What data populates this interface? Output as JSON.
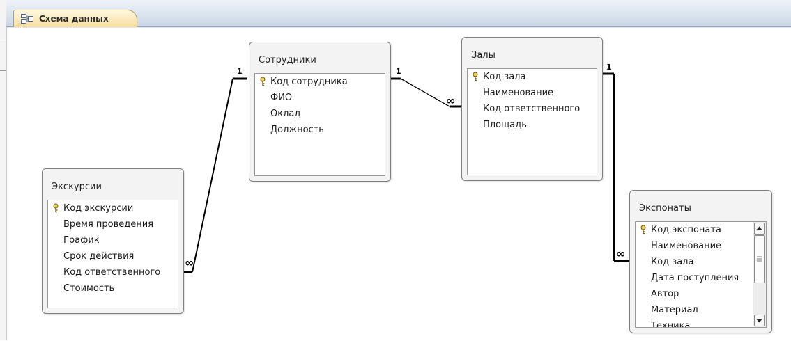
{
  "tab": {
    "label": "Схема данных",
    "icon": "relationships-icon"
  },
  "tables": {
    "sotrudniki": {
      "title": "Сотрудники",
      "fields": [
        {
          "name": "Код сотрудника",
          "key": true
        },
        {
          "name": "ФИО",
          "key": false
        },
        {
          "name": "Оклад",
          "key": false
        },
        {
          "name": "Должность",
          "key": false
        }
      ]
    },
    "zaly": {
      "title": "Залы",
      "fields": [
        {
          "name": "Код зала",
          "key": true
        },
        {
          "name": "Наименование",
          "key": false
        },
        {
          "name": "Код ответственного",
          "key": false
        },
        {
          "name": "Площадь",
          "key": false
        }
      ]
    },
    "ekskursii": {
      "title": "Экскурсии",
      "fields": [
        {
          "name": "Код экскурсии",
          "key": true
        },
        {
          "name": "Время проведения",
          "key": false
        },
        {
          "name": "График",
          "key": false
        },
        {
          "name": "Срок действия",
          "key": false
        },
        {
          "name": "Код ответственного",
          "key": false
        },
        {
          "name": "Стоимость",
          "key": false
        }
      ]
    },
    "eksponaty": {
      "title": "Экспонаты",
      "fields": [
        {
          "name": "Код экспоната",
          "key": true
        },
        {
          "name": "Наименование",
          "key": false
        },
        {
          "name": "Код зала",
          "key": false
        },
        {
          "name": "Дата поступления",
          "key": false
        },
        {
          "name": "Автор",
          "key": false
        },
        {
          "name": "Материал",
          "key": false
        },
        {
          "name": "Техника",
          "key": false
        }
      ]
    }
  },
  "relationships": [
    {
      "one_label": "1",
      "many_label": "∞"
    },
    {
      "one_label": "1",
      "many_label": "∞"
    },
    {
      "one_label": "1",
      "many_label": "∞"
    }
  ],
  "colors": {
    "tab_bg": "#f6dc9c",
    "tabbar_bg": "#cbd7e6",
    "line": "#000000"
  }
}
